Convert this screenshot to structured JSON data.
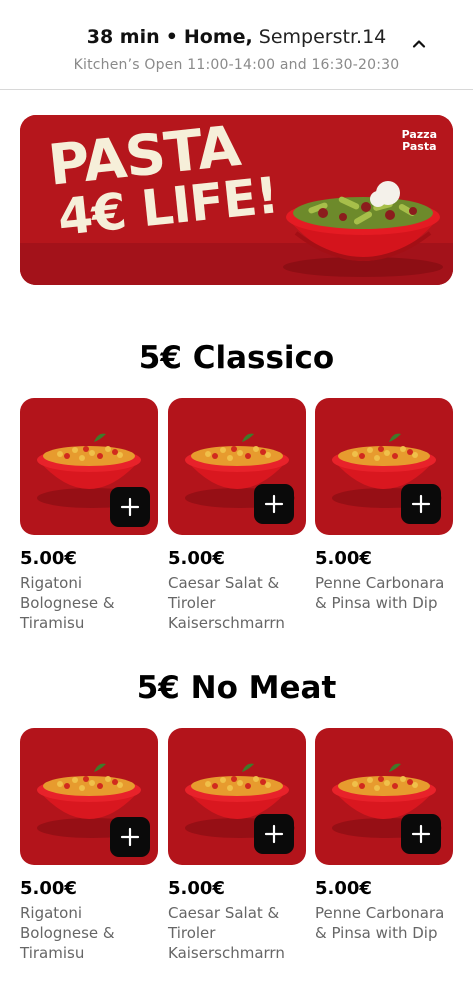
{
  "header": {
    "delivery_time": "38 min",
    "separator": "•",
    "location_label": "Home,",
    "address": "Semperstr.14",
    "hours": "Kitchen’s Open 11:00-14:00 and 16:30-20:30",
    "chevron_icon": "chevron-up-icon"
  },
  "banner": {
    "headline_line1": "PASTA",
    "headline_line2": "4€ LIFE!",
    "brand_line1": "Pazza",
    "brand_line2": "Pasta",
    "colors": {
      "background": "#b5161c",
      "headline": "#f6efd9"
    }
  },
  "sections": [
    {
      "title": "5€ Classico",
      "items": [
        {
          "price": "5.00€",
          "name": "Rigatoni Bolognese & Tiramisu"
        },
        {
          "price": "5.00€",
          "name": "Caesar Salat & Tiroler Kaiserschmarrn"
        },
        {
          "price": "5.00€",
          "name": "Penne Carbonara & Pinsa with Dip"
        }
      ]
    },
    {
      "title": "5€ No Meat",
      "items": [
        {
          "price": "5.00€",
          "name": "Rigatoni Bolognese & Tiramisu"
        },
        {
          "price": "5.00€",
          "name": "Caesar Salat & Tiroler Kaiserschmarrn"
        },
        {
          "price": "5.00€",
          "name": "Penne Carbonara & Pinsa with Dip"
        }
      ]
    }
  ],
  "icons": {
    "add": "plus-icon"
  },
  "colors": {
    "card_background": "#b3141b",
    "add_button": "#0a0a0a"
  }
}
